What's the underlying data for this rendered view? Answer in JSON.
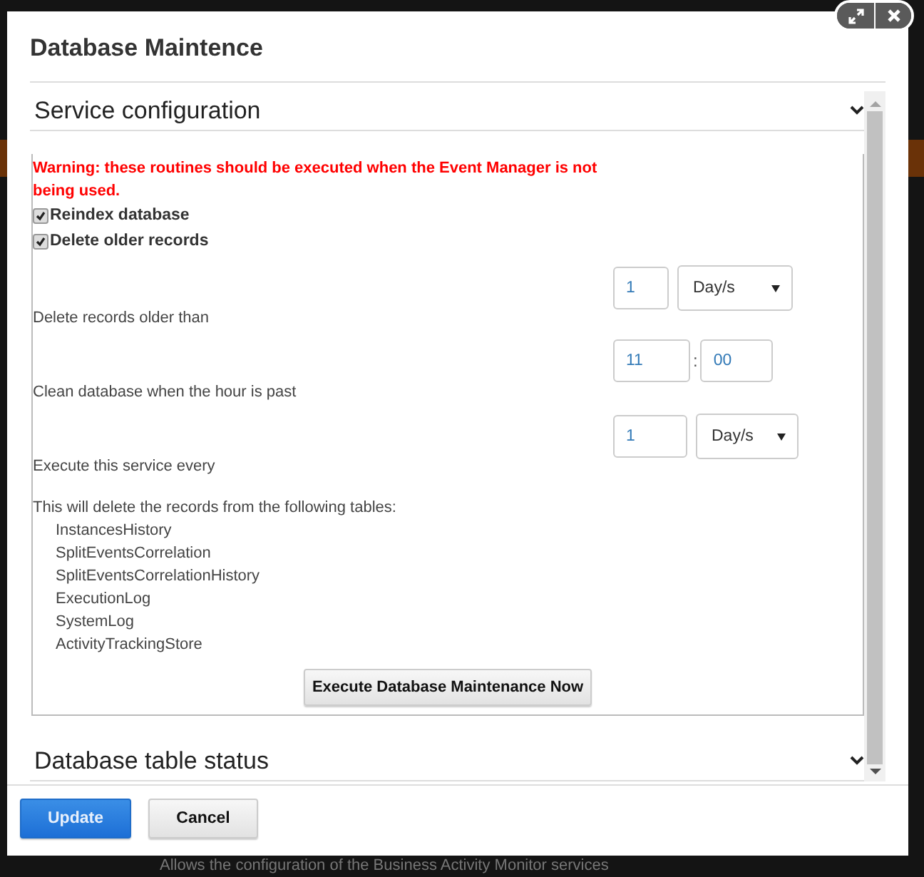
{
  "window_controls": [
    {
      "kind": "expand"
    },
    {
      "kind": "close"
    }
  ],
  "dialog": {
    "title": "Database Maintence"
  },
  "sections": [
    {
      "title": "Service configuration"
    },
    {
      "title": "Database table status"
    }
  ],
  "service_configuration": {
    "warning": "Warning: these routines should be executed when the Event Manager is not being used.",
    "checkboxes": [
      {
        "label": "Reindex database",
        "checked": true
      },
      {
        "label": "Delete older records",
        "checked": true
      }
    ],
    "settings": [
      {
        "kind": "amount",
        "label": "Delete records older than",
        "value": "1",
        "unit": "Day/s"
      },
      {
        "kind": "time",
        "label": "Clean database when the hour is past",
        "hour": "11",
        "separator": ":",
        "minute": "00"
      },
      {
        "kind": "amount",
        "label": "Execute this service every",
        "value": "1",
        "unit": "Day/s"
      }
    ],
    "tables_intro": "This will delete the records from the following tables:",
    "tables": [
      "InstancesHistory",
      "SplitEventsCorrelation",
      "SplitEventsCorrelationHistory",
      "ExecutionLog",
      "SystemLog",
      "ActivityTrackingStore"
    ],
    "execute_button": "Execute Database Maintenance Now"
  },
  "buttons": [
    {
      "label": "Update",
      "kind": "primary"
    },
    {
      "label": "Cancel",
      "kind": "default"
    }
  ],
  "background_text": "Allows the configuration of the Business Activity Monitor services"
}
